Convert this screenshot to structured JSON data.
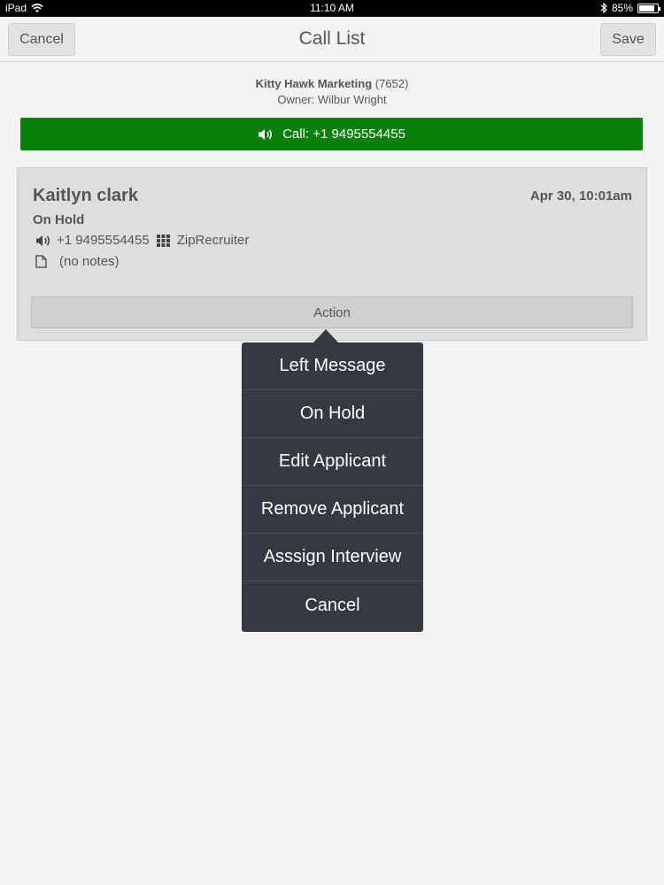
{
  "status_bar": {
    "device": "iPad",
    "time": "11:10 AM",
    "battery": "85%",
    "battery_level": 0.85
  },
  "nav": {
    "cancel_label": "Cancel",
    "title": "Call List",
    "save_label": "Save"
  },
  "account": {
    "name": "Kitty Hawk Marketing",
    "id": "(7652)",
    "owner": "Owner: Wilbur Wright"
  },
  "call_bar": {
    "label": "Call: +1 9495554455",
    "color": "#0a7f0a"
  },
  "applicant": {
    "name": "Kaitlyn clark",
    "date": "Apr 30, 10:01am",
    "status": "On Hold",
    "phone": "+1 9495554455",
    "source": "ZipRecruiter",
    "notes": "(no notes)"
  },
  "action_label": "Action",
  "menu": {
    "items": [
      "Left Message",
      "On Hold",
      "Edit Applicant",
      "Remove Applicant",
      "Asssign Interview",
      "Cancel"
    ]
  },
  "icons": [
    "wifi-icon",
    "bluetooth-icon",
    "battery-icon",
    "speaker-icon",
    "grid-icon",
    "document-icon"
  ]
}
